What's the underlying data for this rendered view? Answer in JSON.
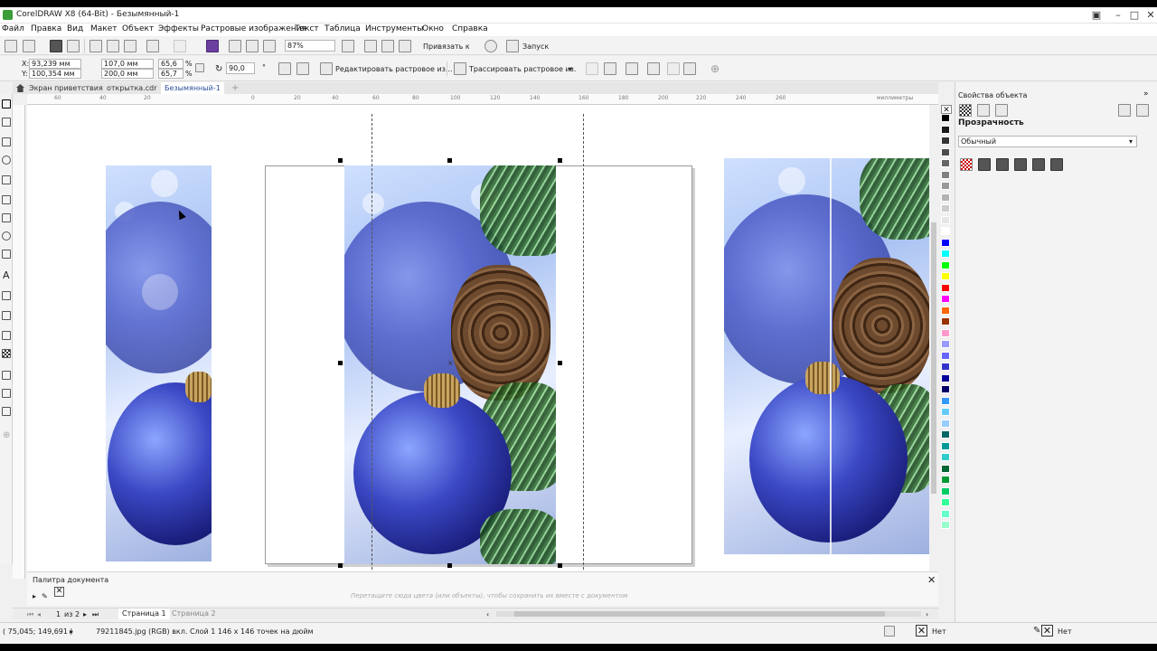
{
  "window": {
    "title": "CorelDRAW X8 (64-Bit) - Безымянный-1"
  },
  "menu": [
    "Файл",
    "Правка",
    "Вид",
    "Макет",
    "Объект",
    "Эффекты",
    "Растровые изображения",
    "Текст",
    "Таблица",
    "Инструменты",
    "Окно",
    "Справка"
  ],
  "standard_toolbar": {
    "zoom": "87%",
    "snap_label": "Привязать к",
    "launch_label": "Запуск"
  },
  "property_bar": {
    "x": "93,239 мм",
    "y": "100,354 мм",
    "width": "107,0 мм",
    "height": "200,0 мм",
    "scale_x": "65,6",
    "scale_y": "65,7",
    "pct": "%",
    "rotation": "90,0",
    "edit_bitmap": "Редактировать растровое из...",
    "trace_bitmap": "Трассировать растровое из."
  },
  "tabs": [
    {
      "label": "Экран приветствия",
      "active": false
    },
    {
      "label": "открытка.cdr",
      "active": false
    },
    {
      "label": "Безымянный-1",
      "active": true
    }
  ],
  "ruler": {
    "units": "миллиметры",
    "h_ticks": [
      "60",
      "40",
      "20",
      "0",
      "20",
      "40",
      "60",
      "80",
      "100",
      "120",
      "140",
      "160",
      "180",
      "200",
      "220",
      "240",
      "260"
    ]
  },
  "object_properties": {
    "title": "Свойства объекта",
    "section": "Прозрачность",
    "mode": "Обычный"
  },
  "doc_palette": {
    "title": "Палитра документа",
    "hint": "Перетащите сюда цвета (или объекты), чтобы сохранить их вместе с документом"
  },
  "pages": {
    "current": "1",
    "of_label": "из",
    "total": "2",
    "page1": "Страница 1",
    "page2": "Страница 2"
  },
  "status": {
    "coords": "( 75,045; 149,691 )",
    "info": "79211845.jpg (RGB) вкл. Слой 1 146 x 146 точек на дюйм",
    "fill": "Нет",
    "outline": "Нет"
  },
  "palette_colors": [
    "#000000",
    "#1a1a1a",
    "#333333",
    "#4d4d4d",
    "#666666",
    "#808080",
    "#999999",
    "#b3b3b3",
    "#cccccc",
    "#e6e6e6",
    "#ffffff",
    "#0000ff",
    "#00ffff",
    "#00ff00",
    "#ffff00",
    "#ff0000",
    "#ff00ff",
    "#ff6600",
    "#993300",
    "#ff99cc",
    "#9999ff",
    "#6666ff",
    "#3333cc",
    "#000099",
    "#000066",
    "#3399ff",
    "#66ccff",
    "#99ccff",
    "#006666",
    "#009999",
    "#33cccc",
    "#006633",
    "#009933",
    "#00cc66",
    "#33ff99",
    "#66ffcc",
    "#99ffcc"
  ]
}
